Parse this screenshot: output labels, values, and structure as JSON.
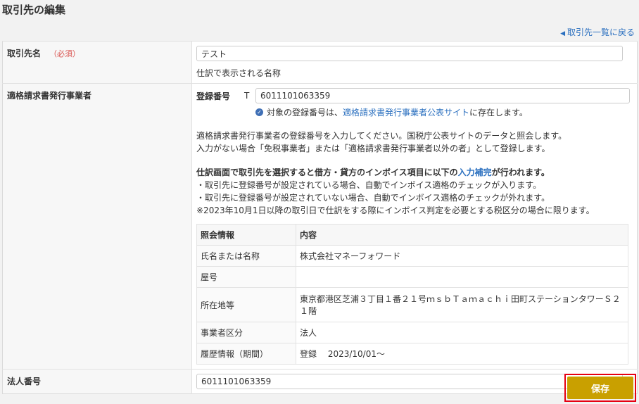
{
  "page": {
    "title": "取引先の編集",
    "back_link": "取引先一覧に戻る"
  },
  "form": {
    "name": {
      "label": "取引先名",
      "required": "（必須）",
      "value": "テスト",
      "hint": "仕訳で表示される名称"
    },
    "invoice": {
      "label": "適格請求書発行事業者",
      "reg_label": "登録番号",
      "reg_prefix": "T",
      "reg_value": "6011101063359",
      "check_text_before": "対象の登録番号は、",
      "check_link": "適格請求書発行事業者公表サイト",
      "check_text_after": "に存在します。",
      "info_line1": "適格請求書発行事業者の登録番号を入力してください。国税庁公表サイトのデータと照会します。",
      "info_line2": "入力がない場合「免税事業者」または「適格請求書発行事業者以外の者」として登録します。",
      "note_bold_before": "仕訳画面で取引先を選択すると借方・貸方のインボイス項目に以下の",
      "note_bold_link": "入力補完",
      "note_bold_after": "が行われます。",
      "note_line1": "・取引先に登録番号が設定されている場合、自動でインボイス適格のチェックが入ります。",
      "note_line2": "・取引先に登録番号が設定されていない場合、自動でインボイス適格のチェックが外れます。",
      "note_line3": "※2023年10月1日以降の取引日で仕訳をする際にインボイス判定を必要とする税区分の場合に限ります。",
      "ref_table": {
        "col1": "照会情報",
        "col2": "内容",
        "rows": [
          {
            "k": "氏名または名称",
            "v": "株式会社マネーフォワード"
          },
          {
            "k": "屋号",
            "v": ""
          },
          {
            "k": "所在地等",
            "v": "東京都港区芝浦３丁目１番２１号ｍｓｂＴａｍａｃｈｉ田町ステーションタワーＳ２１階"
          },
          {
            "k": "事業者区分",
            "v": "法人"
          },
          {
            "k": "履歴情報（期間）",
            "v": "登録　 2023/10/01～"
          }
        ]
      }
    },
    "corp": {
      "label": "法人番号",
      "value": "6011101063359"
    }
  },
  "actions": {
    "save": "保存"
  },
  "colors": {
    "accent": "#c9a000",
    "link": "#2a6fbf",
    "highlight": "#e60012"
  }
}
